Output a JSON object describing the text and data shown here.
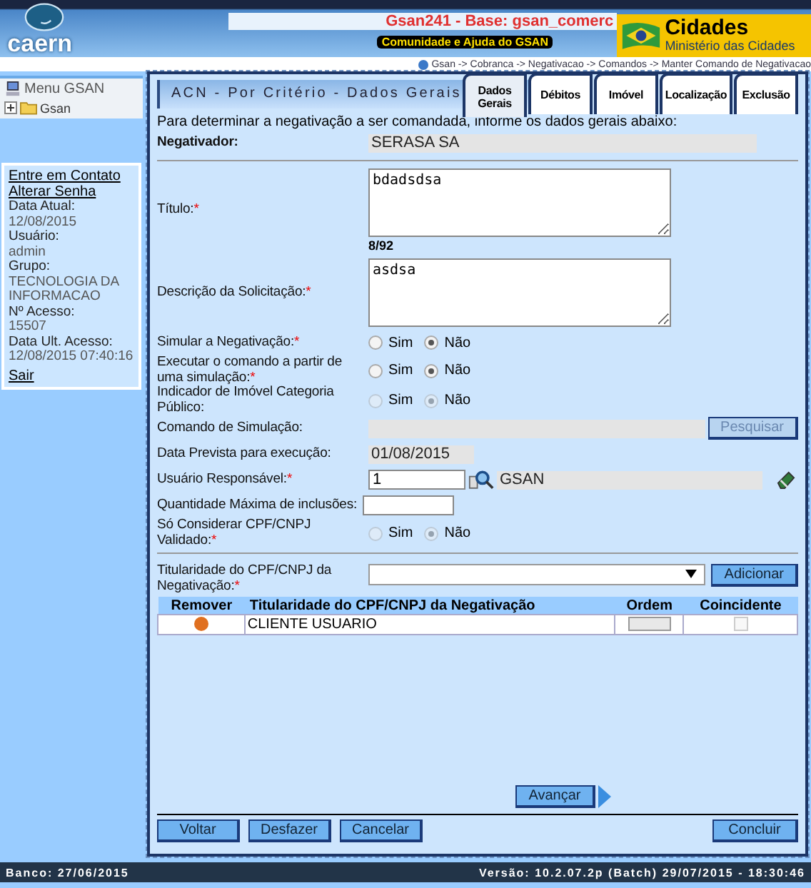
{
  "header": {
    "logo_text": "caern",
    "system_title": "Gsan241 - Base: gsan_comerc",
    "help_link": "Comunidade e Ajuda do GSAN",
    "ministry": {
      "title": "Cidades",
      "subtitle": "Ministério das Cidades"
    },
    "breadcrumb": "Gsan -> Cobranca -> Negativacao -> Comandos -> Manter Comando de Negativacao"
  },
  "sidebar": {
    "menu": {
      "title": "Menu GSAN",
      "items": [
        {
          "label": "Gsan",
          "expanded": false
        }
      ]
    },
    "links": [
      "Entre em Contato",
      "Alterar Senha"
    ],
    "info": [
      {
        "label": "Data Atual:",
        "value": "12/08/2015"
      },
      {
        "label": "Usuário:",
        "value": "admin"
      },
      {
        "label": "Grupo:",
        "value": "TECNOLOGIA DA INFORMACAO"
      },
      {
        "label": "Nº Acesso:",
        "value": "15507"
      },
      {
        "label": "Data Ult. Acesso:",
        "value": "12/08/2015 07:40:16"
      }
    ],
    "logout": "Sair"
  },
  "form": {
    "title": "ACN - Por Critério - Dados Gerais",
    "tabs": [
      {
        "label": "Dados Gerais",
        "selected": true
      },
      {
        "label": "Débitos",
        "selected": false
      },
      {
        "label": "Imóvel",
        "selected": false
      },
      {
        "label": "Localização",
        "selected": false
      },
      {
        "label": "Exclusão",
        "selected": false
      }
    ],
    "intro": "Para determinar a negativação a ser comandada, informe os dados gerais abaixo:",
    "fields": [
      {
        "kind": "readonly",
        "label": "Negativador:",
        "bold": true,
        "value": "SERASA SA"
      },
      {
        "kind": "divider"
      },
      {
        "kind": "textarea",
        "label": "Título:",
        "required": "*",
        "value": "bdadsdsa",
        "counter": "8/92"
      },
      {
        "kind": "textarea",
        "label": "Descrição da Solicitação:",
        "required": "*",
        "value": "asdsa"
      },
      {
        "kind": "radio",
        "label": "Simular a Negativação:",
        "required": "*",
        "disabled": false,
        "options": [
          {
            "label": "Sim",
            "selected": false
          },
          {
            "label": "Não",
            "selected": true
          }
        ]
      },
      {
        "kind": "radio",
        "label": "Executar o comando a partir de uma simulação:",
        "required": "*",
        "disabled": false,
        "options": [
          {
            "label": "Sim",
            "selected": false
          },
          {
            "label": "Não",
            "selected": true
          }
        ]
      },
      {
        "kind": "radio",
        "label": "Indicador de Imóvel Categoria Público:",
        "disabled": true,
        "options": [
          {
            "label": "Sim",
            "selected": false
          },
          {
            "label": "Não",
            "selected": true
          }
        ]
      },
      {
        "kind": "search",
        "label": "Comando de Simulação:",
        "button": "Pesquisar",
        "disabled": true
      },
      {
        "kind": "date",
        "label": "Data Prevista para execução:",
        "value": "01/08/2015"
      },
      {
        "kind": "lookup",
        "label": "Usuário Responsável:",
        "required": "*",
        "code": "1",
        "name": "GSAN"
      },
      {
        "kind": "text",
        "label": "Quantidade Máxima de inclusões:"
      },
      {
        "kind": "radio",
        "label": "Só Considerar CPF/CNPJ Validado:",
        "required": "*",
        "disabled": true,
        "options": [
          {
            "label": "Sim",
            "selected": false
          },
          {
            "label": "Não",
            "selected": true
          }
        ]
      },
      {
        "kind": "divider"
      },
      {
        "kind": "select",
        "label": "Titularidade do CPF/CNPJ da Negativação:",
        "required": "*",
        "button": "Adicionar"
      }
    ],
    "table": {
      "columns": [
        "Remover",
        "Titularidade do CPF/CNPJ da Negativação",
        "Ordem",
        "Coincidente"
      ],
      "rows": [
        {
          "titularidade": "CLIENTE USUARIO",
          "coincidente": false
        }
      ]
    },
    "next_button": "Avançar",
    "buttons": [
      "Voltar",
      "Desfazer",
      "Cancelar"
    ],
    "submit_button": "Concluir"
  },
  "footer": {
    "left": "Banco: 27/06/2015",
    "right": "Versão: 10.2.07.2p (Batch) 29/07/2015 - 18:30:46"
  }
}
